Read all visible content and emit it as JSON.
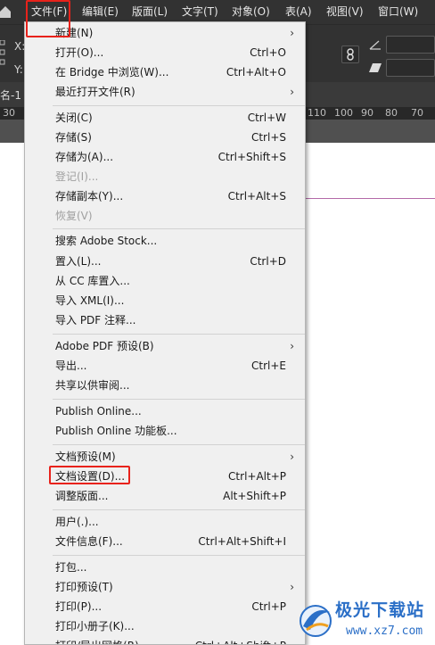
{
  "menubar": {
    "items": [
      "文件(F)",
      "编辑(E)",
      "版面(L)",
      "文字(T)",
      "对象(O)",
      "表(A)",
      "视图(V)",
      "窗口(W)"
    ]
  },
  "control": {
    "x_label": "X:",
    "y_label": "Y:"
  },
  "document": {
    "tab_label": "名-1"
  },
  "ruler": {
    "ticks": [
      "30",
      "110",
      "100",
      "90",
      "80",
      "70"
    ]
  },
  "file_menu": {
    "items": [
      {
        "label": "新建(N)",
        "shortcut": "",
        "submenu": true,
        "disabled": false
      },
      {
        "label": "打开(O)...",
        "shortcut": "Ctrl+O",
        "submenu": false,
        "disabled": false
      },
      {
        "label": "在 Bridge 中浏览(W)...",
        "shortcut": "Ctrl+Alt+O",
        "submenu": false,
        "disabled": false
      },
      {
        "label": "最近打开文件(R)",
        "shortcut": "",
        "submenu": true,
        "disabled": false
      },
      {
        "label": "关闭(C)",
        "shortcut": "Ctrl+W",
        "submenu": false,
        "disabled": false
      },
      {
        "label": "存储(S)",
        "shortcut": "Ctrl+S",
        "submenu": false,
        "disabled": false
      },
      {
        "label": "存储为(A)...",
        "shortcut": "Ctrl+Shift+S",
        "submenu": false,
        "disabled": false
      },
      {
        "label": "登记(I)...",
        "shortcut": "",
        "submenu": false,
        "disabled": true
      },
      {
        "label": "存储副本(Y)...",
        "shortcut": "Ctrl+Alt+S",
        "submenu": false,
        "disabled": false
      },
      {
        "label": "恢复(V)",
        "shortcut": "",
        "submenu": false,
        "disabled": true
      },
      {
        "label": "搜索 Adobe Stock...",
        "shortcut": "",
        "submenu": false,
        "disabled": false
      },
      {
        "label": "置入(L)...",
        "shortcut": "Ctrl+D",
        "submenu": false,
        "disabled": false
      },
      {
        "label": "从 CC 库置入...",
        "shortcut": "",
        "submenu": false,
        "disabled": false
      },
      {
        "label": "导入 XML(I)...",
        "shortcut": "",
        "submenu": false,
        "disabled": false
      },
      {
        "label": "导入 PDF 注释...",
        "shortcut": "",
        "submenu": false,
        "disabled": false
      },
      {
        "label": "Adobe PDF 预设(B)",
        "shortcut": "",
        "submenu": true,
        "disabled": false
      },
      {
        "label": "导出...",
        "shortcut": "Ctrl+E",
        "submenu": false,
        "disabled": false
      },
      {
        "label": "共享以供审阅...",
        "shortcut": "",
        "submenu": false,
        "disabled": false
      },
      {
        "label": "Publish Online...",
        "shortcut": "",
        "submenu": false,
        "disabled": false
      },
      {
        "label": "Publish Online 功能板...",
        "shortcut": "",
        "submenu": false,
        "disabled": false
      },
      {
        "label": "文档预设(M)",
        "shortcut": "",
        "submenu": true,
        "disabled": false
      },
      {
        "label": "文档设置(D)...",
        "shortcut": "Ctrl+Alt+P",
        "submenu": false,
        "disabled": false
      },
      {
        "label": "调整版面...",
        "shortcut": "Alt+Shift+P",
        "submenu": false,
        "disabled": false
      },
      {
        "label": "用户(.)...",
        "shortcut": "",
        "submenu": false,
        "disabled": false
      },
      {
        "label": "文件信息(F)...",
        "shortcut": "Ctrl+Alt+Shift+I",
        "submenu": false,
        "disabled": false
      },
      {
        "label": "打包...",
        "shortcut": "",
        "submenu": false,
        "disabled": false
      },
      {
        "label": "打印预设(T)",
        "shortcut": "",
        "submenu": true,
        "disabled": false
      },
      {
        "label": "打印(P)...",
        "shortcut": "Ctrl+P",
        "submenu": false,
        "disabled": false
      },
      {
        "label": "打印小册子(K)...",
        "shortcut": "",
        "submenu": false,
        "disabled": false
      },
      {
        "label": "打印/导出网格(R)...",
        "shortcut": "Ctrl+Alt+Shift+P",
        "submenu": false,
        "disabled": false
      }
    ]
  },
  "watermark": {
    "title": "极光下载站",
    "url": "www.xz7.com"
  },
  "colors": {
    "highlight": "#e8221b",
    "menu_bg": "#f0f0f0",
    "app_bar": "#323232",
    "watermark": "#2b6fc7"
  }
}
